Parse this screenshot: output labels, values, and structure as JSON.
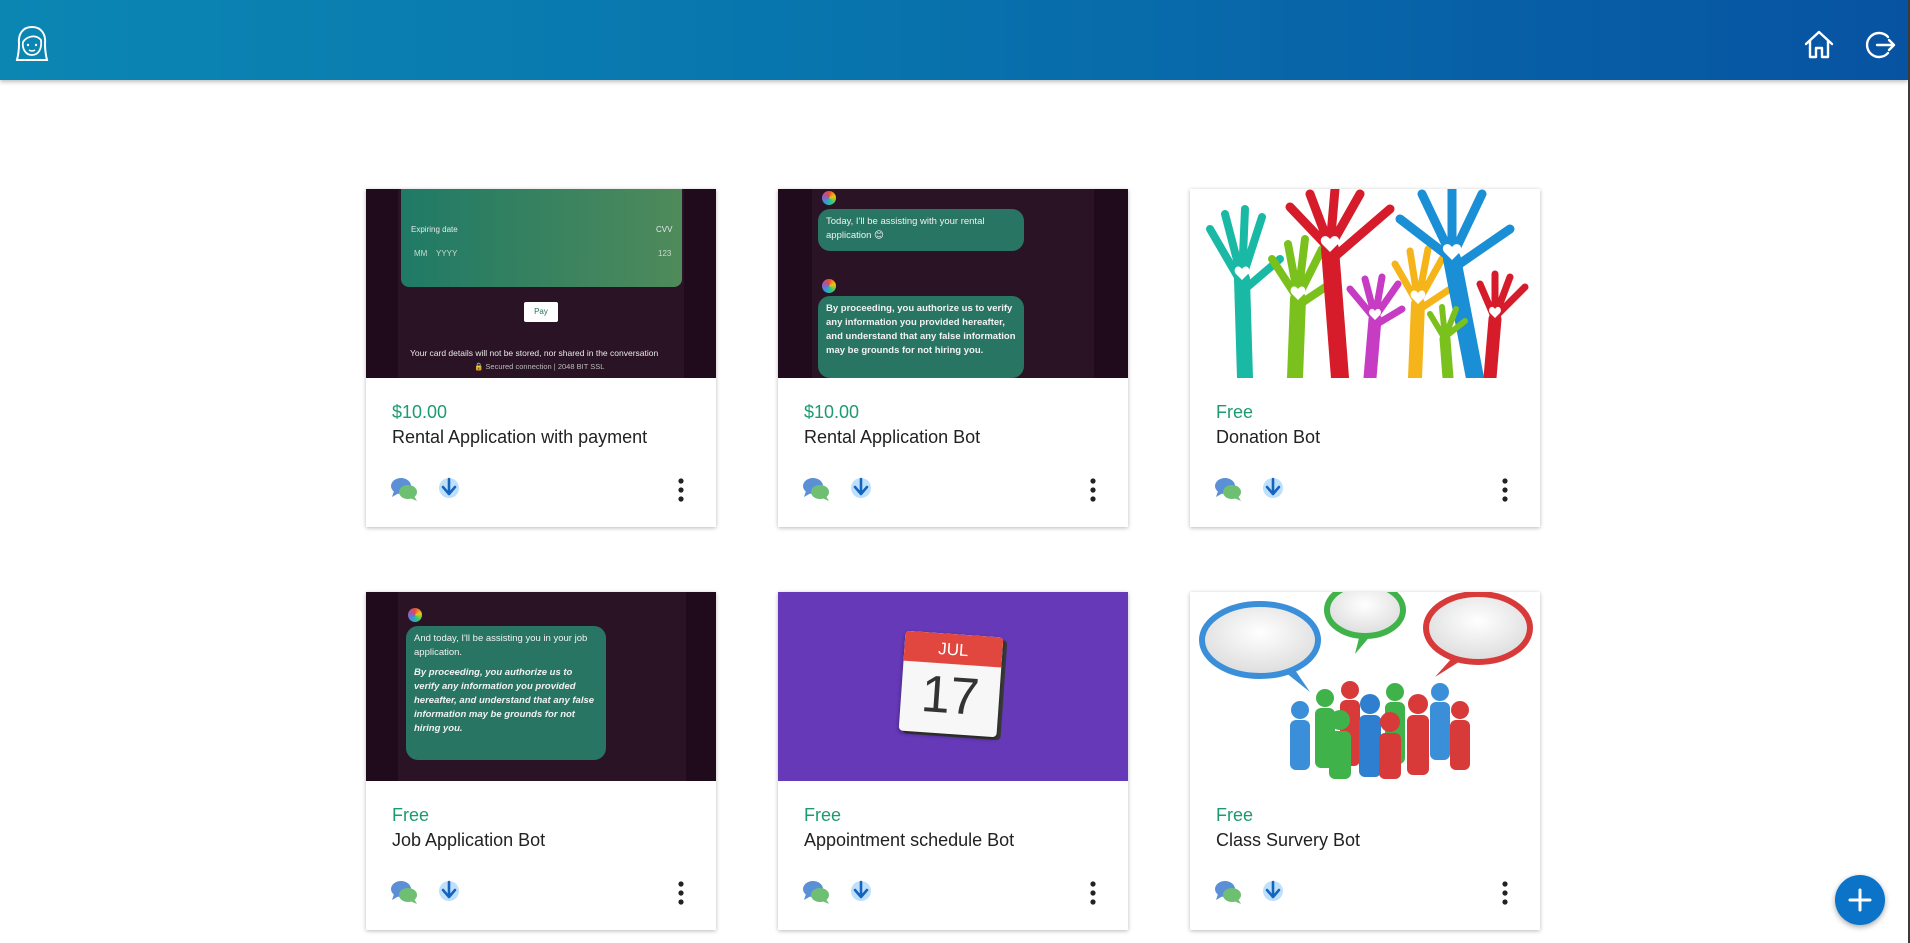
{
  "header": {
    "logo_icon": "assistant-avatar-icon",
    "home_icon": "home-icon",
    "logout_icon": "logout-icon"
  },
  "colors": {
    "header_start": "#0b86b3",
    "header_end": "#0753a2",
    "price": "#1d9a72",
    "fab": "#0b74c9"
  },
  "cards": [
    {
      "price": "$10.00",
      "title": "Rental Application with payment",
      "thumb": {
        "label_expiry": "Expiring date",
        "label_cvv": "CVV",
        "placeholder_month": "MM",
        "placeholder_year": "YYYY",
        "placeholder_cvv": "123",
        "pay_button": "Pay",
        "notice": "Your card details will not be stored, nor shared in the conversation",
        "secure": "🔒 Secured connection | 2048 BIT SSL"
      }
    },
    {
      "price": "$10.00",
      "title": "Rental Application Bot",
      "thumb": {
        "msg1": "Today, I'll be assisting with your rental application 😊",
        "msg2": "By proceeding, you authorize us to verify any information you provided hereafter, and understand that any false information may be grounds for not hiring you."
      }
    },
    {
      "price": "Free",
      "title": "Donation Bot"
    },
    {
      "price": "Free",
      "title": "Job Application Bot",
      "thumb": {
        "msg1": "And today, I'll be assisting you in your job application.",
        "msg2": "By proceeding, you authorize us to verify any information you provided hereafter, and understand that any false information may be grounds for not hiring you."
      }
    },
    {
      "price": "Free",
      "title": "Appointment schedule Bot",
      "thumb": {
        "month": "JUL",
        "day": "17"
      }
    },
    {
      "price": "Free",
      "title": "Class Survery Bot"
    }
  ],
  "card_icons": {
    "chat": "chat-bubbles-icon",
    "download": "download-arrow-icon",
    "more": "more-vertical-icon"
  },
  "fab": {
    "icon": "plus-icon"
  }
}
